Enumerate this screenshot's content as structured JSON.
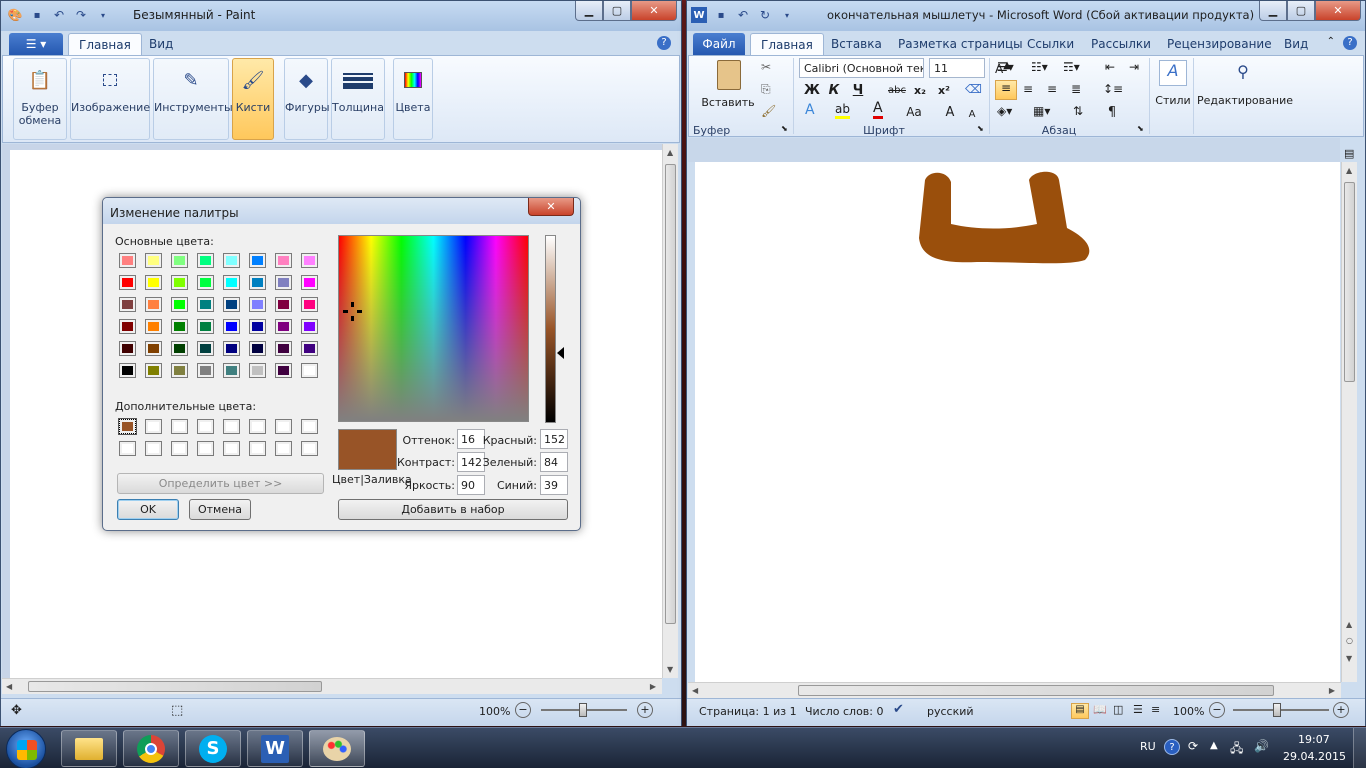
{
  "paint": {
    "title": "Безымянный - Paint",
    "tabs": {
      "home": "Главная",
      "view": "Вид"
    },
    "groups": {
      "clipboard": "Буфер обмена",
      "image": "Изображение",
      "tools": "Инструменты",
      "brushes": "Кисти",
      "shapes": "Фигуры",
      "size": "Толщина",
      "colors": "Цвета"
    },
    "status": {
      "zoom": "100%"
    }
  },
  "dialog": {
    "title": "Изменение палитры",
    "basic_label": "Основные цвета:",
    "custom_label": "Дополнительные цвета:",
    "define_button": "Определить цвет >>",
    "ok": "OK",
    "cancel": "Отмена",
    "add_button": "Добавить в набор",
    "preview_label": "Цвет|Заливка",
    "fields": {
      "hue_label": "Оттенок:",
      "hue": "16",
      "sat_label": "Контраст:",
      "sat": "142",
      "lum_label": "Яркость:",
      "lum": "90",
      "red_label": "Красный:",
      "red": "152",
      "green_label": "Зеленый:",
      "green": "84",
      "blue_label": "Синий:",
      "blue": "39"
    },
    "selected_color": "#985427",
    "basic_colors": [
      [
        "#ff8080",
        "#ffff80",
        "#80ff80",
        "#00ff80",
        "#80ffff",
        "#0080ff",
        "#ff80c0",
        "#ff80ff"
      ],
      [
        "#ff0000",
        "#ffff00",
        "#80ff00",
        "#00ff40",
        "#00ffff",
        "#0080c0",
        "#8080c0",
        "#ff00ff"
      ],
      [
        "#804040",
        "#ff8040",
        "#00ff00",
        "#008080",
        "#004080",
        "#8080ff",
        "#800040",
        "#ff0080"
      ],
      [
        "#800000",
        "#ff8000",
        "#008000",
        "#008040",
        "#0000ff",
        "#0000a0",
        "#800080",
        "#8000ff"
      ],
      [
        "#400000",
        "#804000",
        "#004000",
        "#004040",
        "#000080",
        "#000040",
        "#400040",
        "#400080"
      ],
      [
        "#000000",
        "#808000",
        "#808040",
        "#808080",
        "#408080",
        "#c0c0c0",
        "#400040",
        "#ffffff"
      ]
    ],
    "custom_colors": [
      [
        "#985427",
        "#ffffff",
        "#ffffff",
        "#ffffff",
        "#ffffff",
        "#ffffff",
        "#ffffff",
        "#ffffff"
      ],
      [
        "#ffffff",
        "#ffffff",
        "#ffffff",
        "#ffffff",
        "#ffffff",
        "#ffffff",
        "#ffffff",
        "#ffffff"
      ]
    ]
  },
  "word": {
    "title": "окончательная мышлетуч - Microsoft Word (Сбой активации продукта)",
    "tabs": {
      "file": "Файл",
      "home": "Главная",
      "insert": "Вставка",
      "layout": "Разметка страницы",
      "refs": "Ссылки",
      "mailings": "Рассылки",
      "review": "Рецензирование",
      "view": "Вид"
    },
    "ribbon": {
      "paste": "Вставить",
      "clipboard_group": "Буфер обмена",
      "font_group": "Шрифт",
      "para_group": "Абзац",
      "styles": "Стили",
      "editing": "Редактирование",
      "font_name": "Calibri (Основной тек",
      "font_size": "11",
      "bold": "Ж",
      "italic": "К",
      "underline": "Ч",
      "strike": "abc",
      "sub": "x₂",
      "sup": "x²",
      "case": "Aa",
      "grow": "A",
      "shrink": "A",
      "pilcrow": "¶"
    },
    "drawing_color": "#9a4f0c",
    "status": {
      "page": "Страница: 1 из 1",
      "words": "Число слов: 0",
      "lang": "русский",
      "zoom": "100%"
    }
  },
  "taskbar": {
    "lang": "RU",
    "time": "19:07",
    "date": "29.04.2015"
  }
}
